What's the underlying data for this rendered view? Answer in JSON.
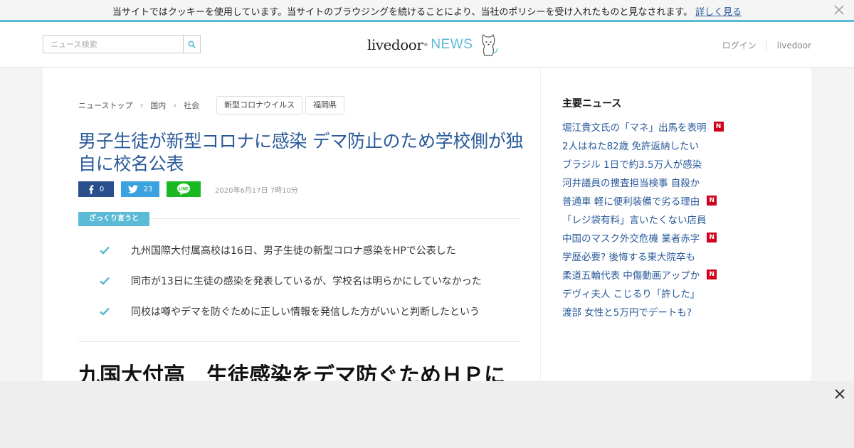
{
  "cookie": {
    "message": "当サイトではクッキーを使用しています。当サイトのブラウジングを続けることにより、当社のポリシーを受け入れたものと見なされます。",
    "link": "詳しく見る"
  },
  "header": {
    "search_placeholder": "ニュース検索",
    "logo_livedoor": "livedoor",
    "logo_news": "NEWS",
    "login": "ログイン",
    "livedoor_link": "livedoor"
  },
  "breadcrumb": [
    "ニューストップ",
    "国内",
    "社会"
  ],
  "tags": [
    "新型コロナウイルス",
    "福岡県"
  ],
  "article": {
    "headline": "男子生徒が新型コロナに感染 デマ防止のため学校側が独自に校名公表",
    "share_fb_count": "0",
    "share_tw_count": "23",
    "date": "2020年6月17日 7時10分",
    "summary_label": "ざっくり言うと",
    "points": [
      "九州国際大付属高校は16日、男子生徒の新型コロナ感染をHPで公表した",
      "同市が13日に生徒の感染を発表しているが、学校名は明らかにしていなかった",
      "同校は噂やデマを防ぐために正しい情報を発信した方がいいと判断したという"
    ],
    "body_title": "九国大付高　生徒感染をデマ防ぐためＨＰに"
  },
  "sidebar": {
    "title": "主要ニュース",
    "items": [
      {
        "text": "堀江貴文氏の「マネ」出馬を表明",
        "new": true
      },
      {
        "text": "2人はねた82歳 免許返納したい",
        "new": false
      },
      {
        "text": "ブラジル 1日で約3.5万人が感染",
        "new": false
      },
      {
        "text": "河井議員の捜査担当検事 自殺か",
        "new": false
      },
      {
        "text": "普通車 軽に便利装備で劣る理由",
        "new": true
      },
      {
        "text": "「レジ袋有料」言いたくない店員",
        "new": false
      },
      {
        "text": "中国のマスク外交危機 業者赤字",
        "new": true
      },
      {
        "text": "学歴必要? 後悔する東大院卒も",
        "new": false
      },
      {
        "text": "柔道五輪代表 中傷動画アップか",
        "new": true
      },
      {
        "text": "デヴィ夫人 こじるり「許した」",
        "new": false
      },
      {
        "text": "渡部 女性と5万円でデートも?",
        "new": false
      }
    ],
    "badge": "N"
  },
  "colors": {
    "accent": "#5bbad5",
    "link": "#2a5a9a",
    "facebook": "#2a4f8c",
    "twitter": "#3aa2de",
    "line": "#1ab822",
    "new_badge": "#d0021b"
  }
}
